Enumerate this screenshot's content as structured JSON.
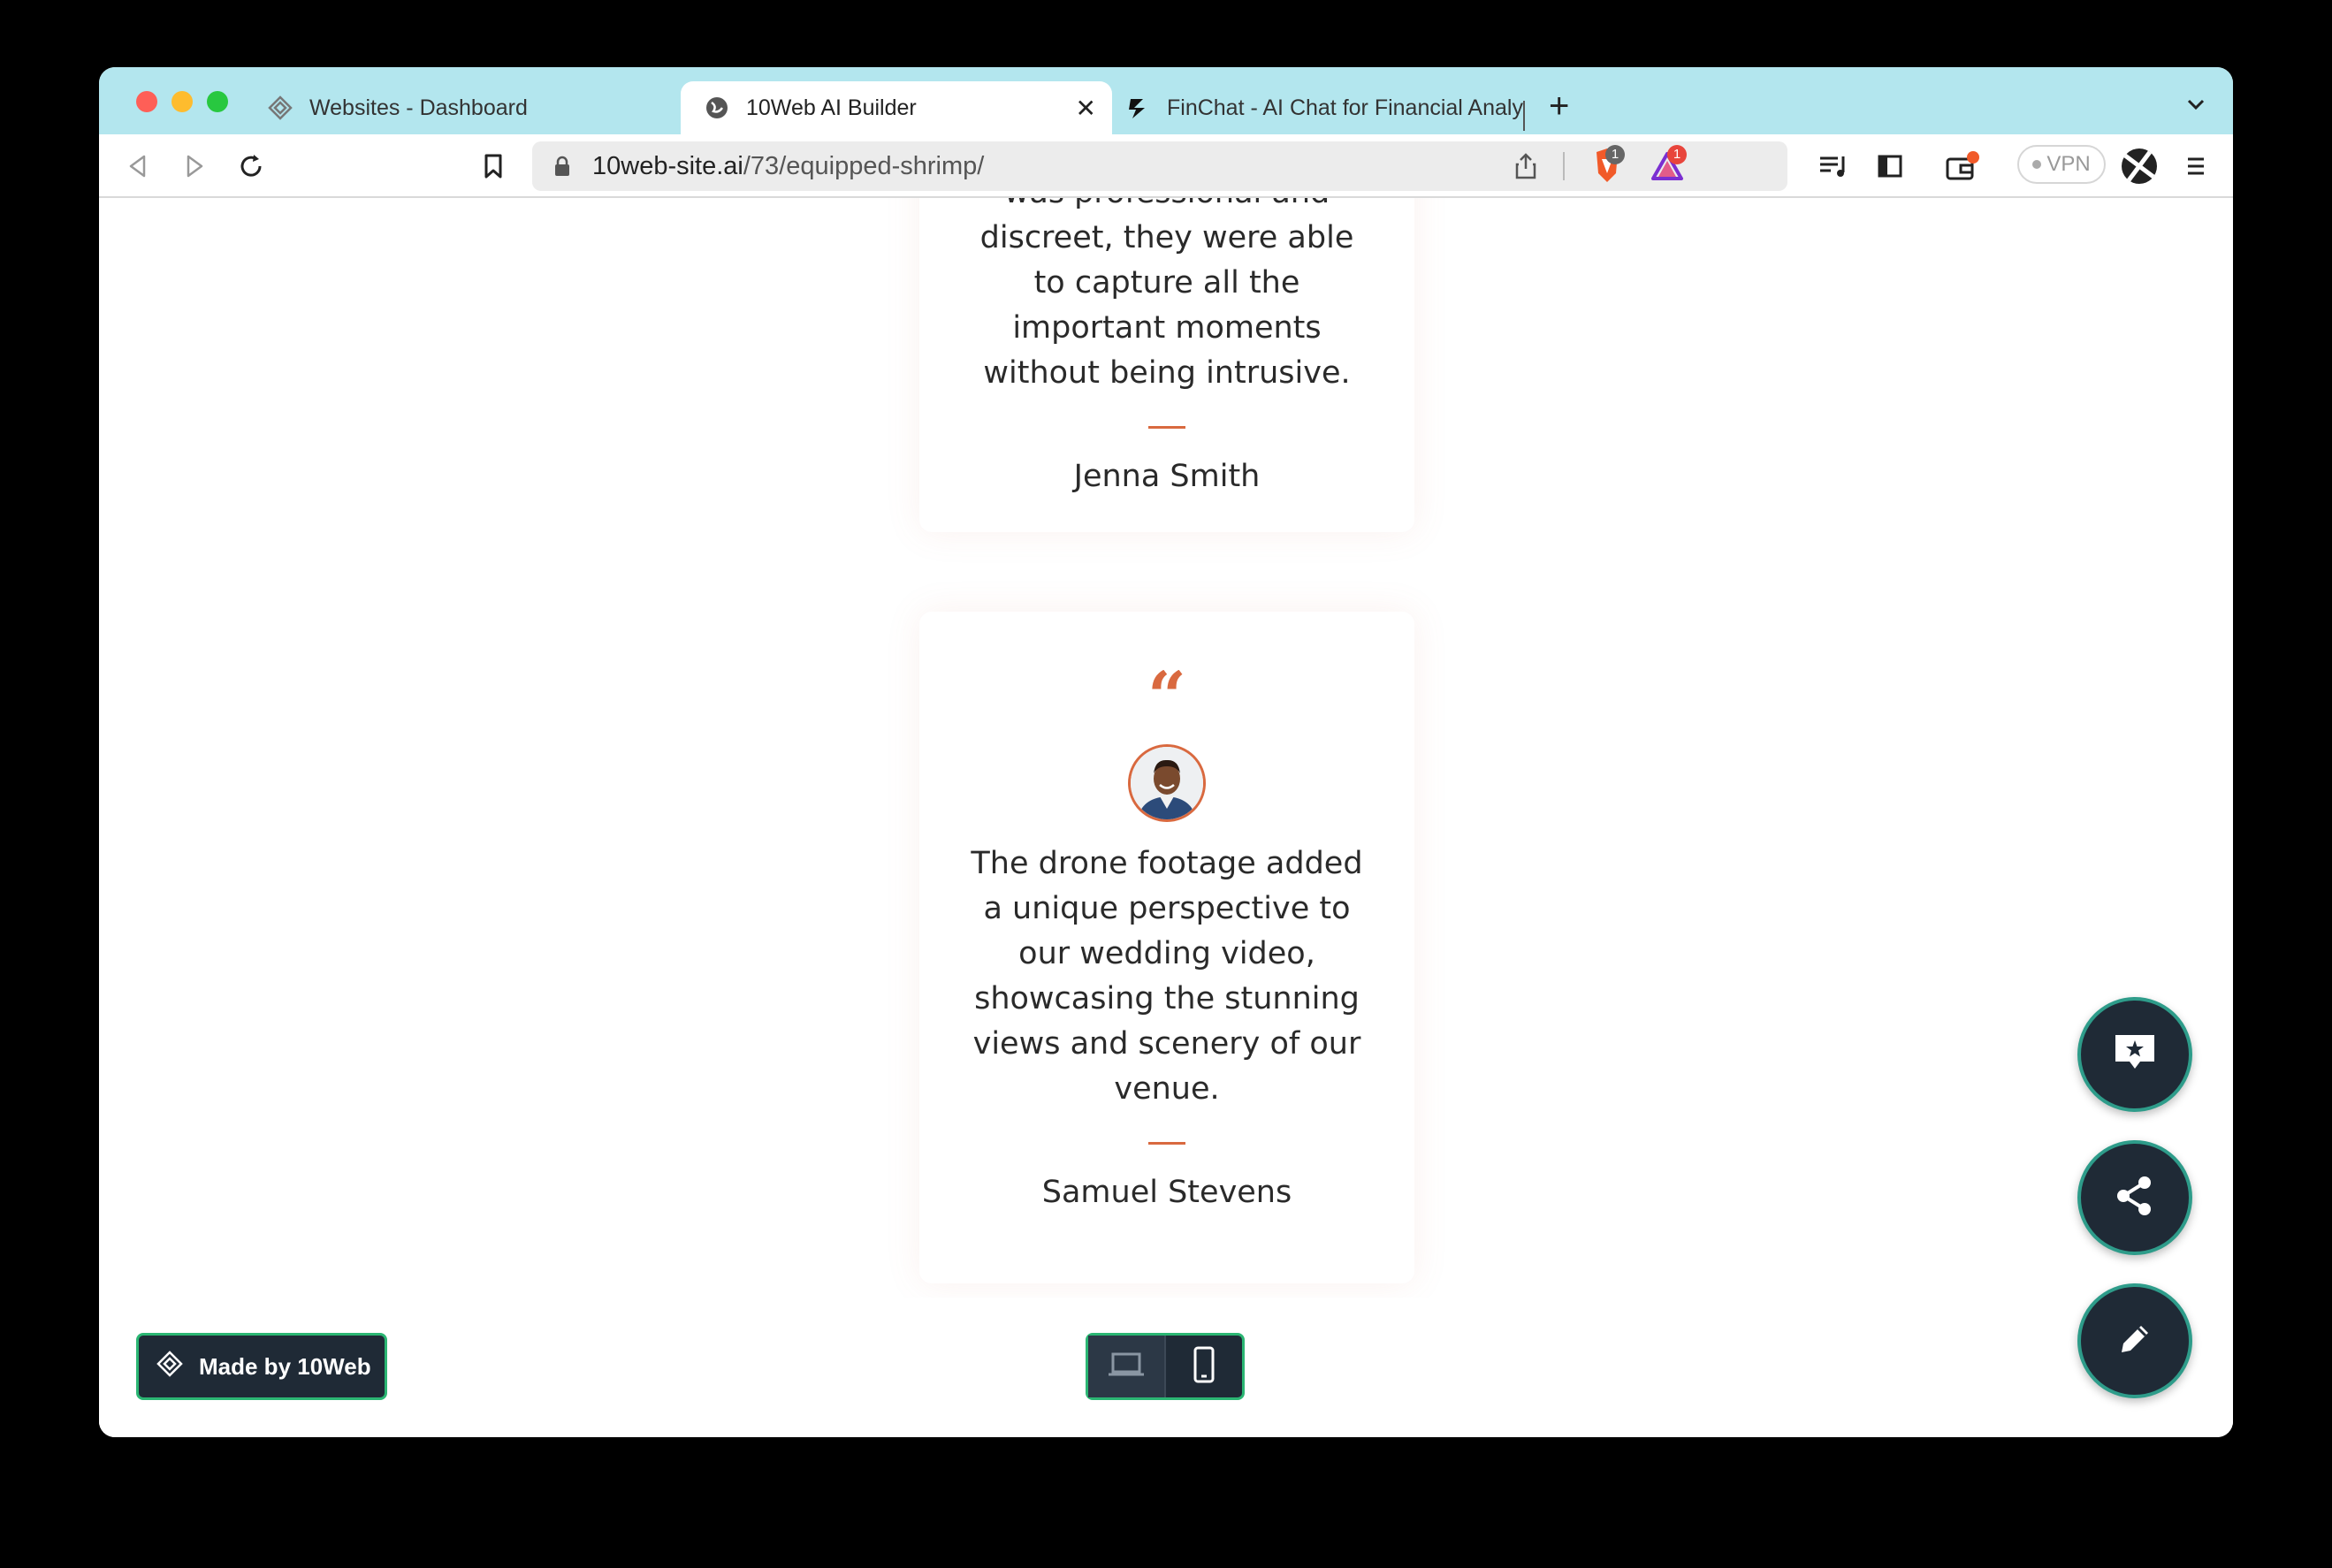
{
  "browser": {
    "tabs": [
      {
        "label": "Websites - Dashboard",
        "icon": "tenweb-logo-icon"
      },
      {
        "label": "10Web AI Builder",
        "icon": "globe-icon",
        "active": true
      },
      {
        "label": "FinChat - AI Chat for Financial Analy",
        "icon": "finchat-logo-icon"
      }
    ],
    "url_host": "10web-site.ai",
    "url_path": "/73/equipped-shrimp/",
    "brave_shield_count": "1",
    "brave_rewards_count": "1",
    "vpn_label": "VPN"
  },
  "testimonials": [
    {
      "text_partial": "was professional and",
      "text": "discreet, they were able to capture all the important moments without being intrusive.",
      "author": "Jenna Smith"
    },
    {
      "quote_mark": "“",
      "text": "The drone footage added a unique perspective to our wedding video, showcasing the stunning views and scenery of our venue.",
      "author": "Samuel Stevens"
    }
  ],
  "footer": {
    "made_by_label": "Made by 10Web"
  },
  "colors": {
    "accent": "#d9693f",
    "tabstrip": "#b3e6ee",
    "dark_ui": "#1f2a36",
    "green_border": "#2bb673"
  }
}
